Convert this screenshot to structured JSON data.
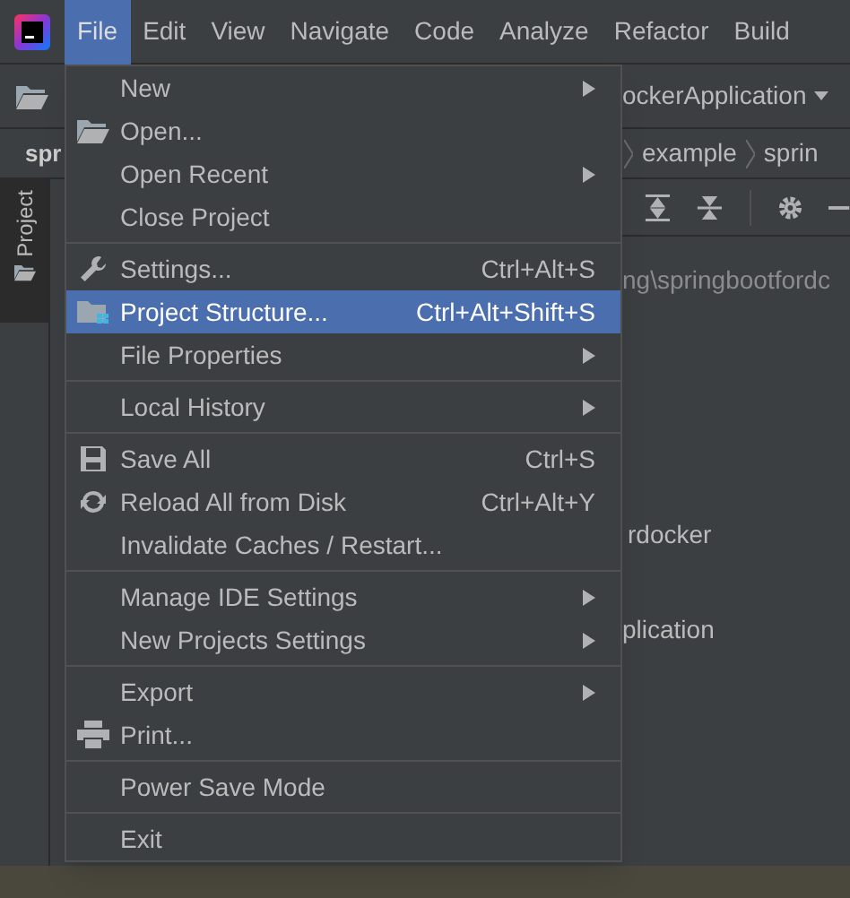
{
  "menubar": [
    {
      "label": "File",
      "selected": true
    },
    {
      "label": "Edit",
      "selected": false
    },
    {
      "label": "View",
      "selected": false
    },
    {
      "label": "Navigate",
      "selected": false
    },
    {
      "label": "Code",
      "selected": false
    },
    {
      "label": "Analyze",
      "selected": false
    },
    {
      "label": "Refactor",
      "selected": false
    },
    {
      "label": "Build",
      "selected": false
    }
  ],
  "project_tab": "spr",
  "tool_window": "Project",
  "run_config": "ockerApplication",
  "breadcrumb": [
    "example",
    "sprin"
  ],
  "editor_texts": [
    "ng\\springbootfordc",
    "rdocker",
    "plication"
  ],
  "menu": [
    [
      {
        "label": "New",
        "submenu": true,
        "selected": false
      },
      {
        "label": "Open...",
        "submenu": false,
        "selected": false
      },
      {
        "label": "Open Recent",
        "submenu": true,
        "selected": false
      },
      {
        "label": "Close Project",
        "submenu": false,
        "selected": false
      }
    ],
    [
      {
        "label": "Settings...",
        "shortcut": "Ctrl+Alt+S",
        "submenu": false,
        "selected": false
      },
      {
        "label": "Project Structure...",
        "shortcut": "Ctrl+Alt+Shift+S",
        "submenu": false,
        "selected": true
      },
      {
        "label": "File Properties",
        "submenu": true,
        "selected": false
      }
    ],
    [
      {
        "label": "Local History",
        "submenu": true,
        "selected": false
      }
    ],
    [
      {
        "label": "Save All",
        "shortcut": "Ctrl+S",
        "submenu": false,
        "selected": false
      },
      {
        "label": "Reload All from Disk",
        "shortcut": "Ctrl+Alt+Y",
        "submenu": false,
        "selected": false
      },
      {
        "label": "Invalidate Caches / Restart...",
        "submenu": false,
        "selected": false
      }
    ],
    [
      {
        "label": "Manage IDE Settings",
        "submenu": true,
        "selected": false
      },
      {
        "label": "New Projects Settings",
        "submenu": true,
        "selected": false
      }
    ],
    [
      {
        "label": "Export",
        "submenu": true,
        "selected": false
      },
      {
        "label": "Print...",
        "submenu": false,
        "selected": false
      }
    ],
    [
      {
        "label": "Power Save Mode",
        "submenu": false,
        "selected": false
      }
    ],
    [
      {
        "label": "Exit",
        "submenu": false,
        "selected": false
      }
    ]
  ]
}
